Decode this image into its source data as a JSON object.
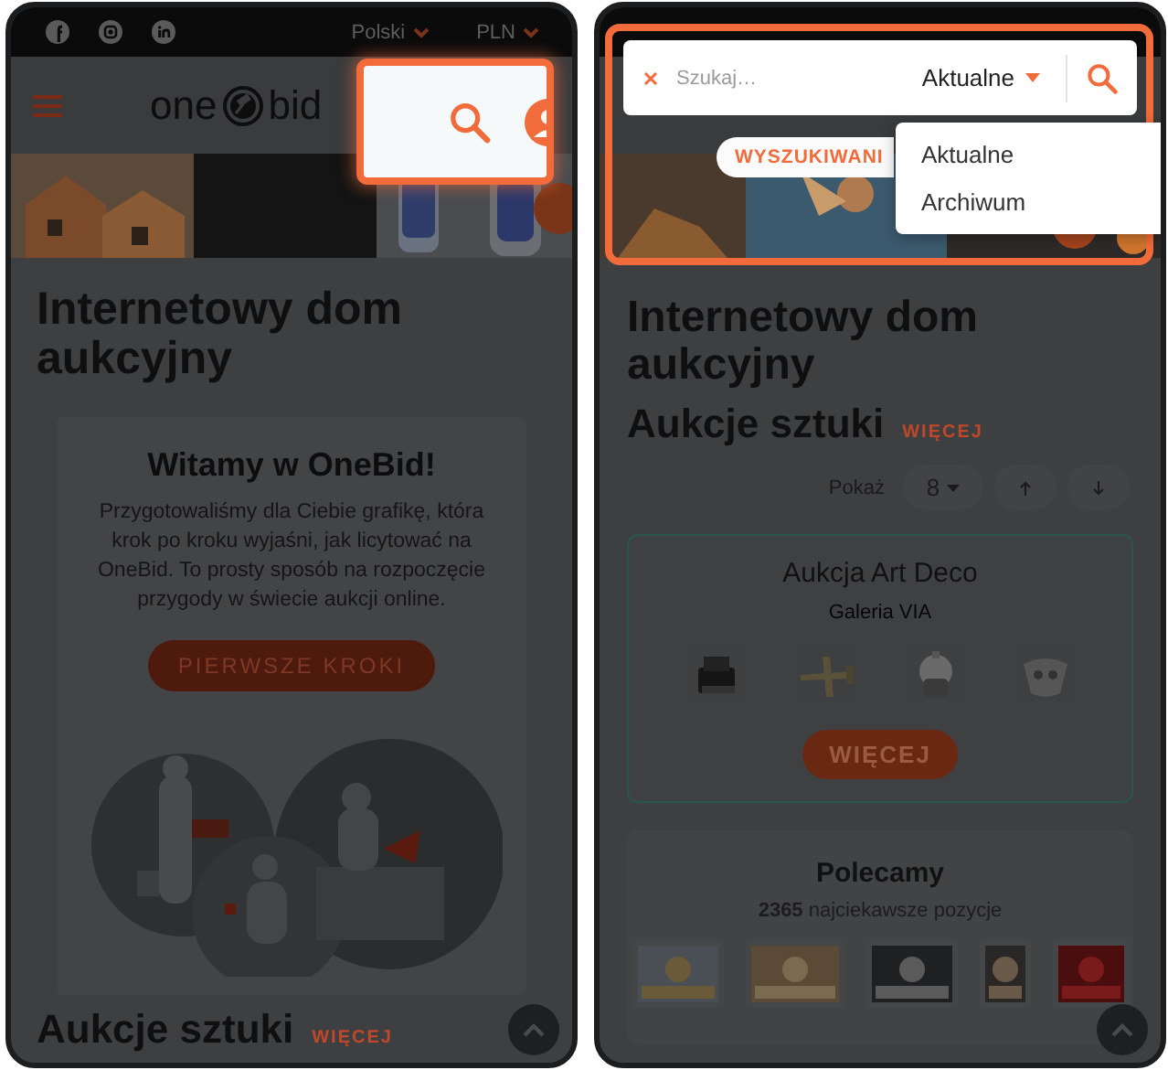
{
  "left_screen": {
    "topbar": {
      "language": "Polski",
      "currency": "PLN"
    },
    "logo": {
      "left": "one",
      "right": "bid"
    },
    "heading": "Internetowy dom aukcyjny",
    "welcome": {
      "title": "Witamy w OneBid!",
      "text": "Przygotowaliśmy dla Ciebie grafikę, która krok po kroku wyjaśni, jak licytować na OneBid. To prosty sposób na rozpoczęcie przygody w świecie aukcji online.",
      "button": "PIERWSZE KROKI"
    },
    "section": {
      "title": "Aukcje sztuki",
      "link": "WIĘCEJ"
    }
  },
  "right_screen": {
    "search": {
      "placeholder": "Szukaj…",
      "scope": "Aktualne",
      "options": [
        {
          "label": "Aktualne"
        },
        {
          "label": "Archiwum"
        }
      ]
    },
    "badge": "WYSZUKIWANI",
    "heading": "Internetowy dom aukcyjny",
    "section": {
      "title": "Aukcje sztuki",
      "link": "WIĘCEJ"
    },
    "sort": {
      "label": "Pokaż",
      "count": "8"
    },
    "auction_card": {
      "title": "Aukcja Art Deco",
      "seller": "Galeria VIA",
      "button": "WIĘCEJ"
    },
    "featured": {
      "title": "Polecamy",
      "summary": "**2365** najciekawsze pozycje"
    }
  }
}
